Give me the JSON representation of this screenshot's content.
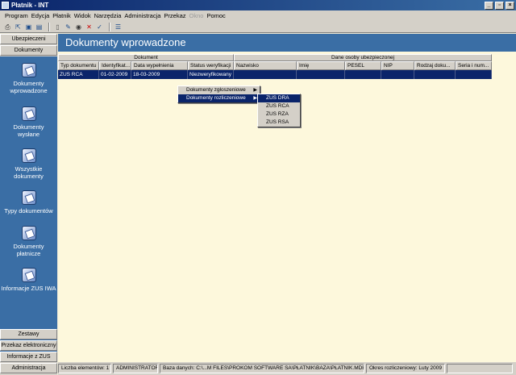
{
  "window": {
    "title": "Płatnik - INT",
    "min": "_",
    "max": "▫",
    "close": "×"
  },
  "menu": [
    "Program",
    "Edycja",
    "Płatnik",
    "Widok",
    "Narzędzia",
    "Administracja",
    "Przekaz",
    "Okno",
    "Pomoc"
  ],
  "menu_disabled_index": 7,
  "sidebar": {
    "top_buttons": [
      "Ubezpieczeni",
      "Dokumenty"
    ],
    "items": [
      {
        "label1": "Dokumenty",
        "label2": "wprowadzone",
        "icon": "doc-in-icon"
      },
      {
        "label1": "Dokumenty",
        "label2": "wysłane",
        "icon": "doc-sent-icon"
      },
      {
        "label1": "Wszystkie",
        "label2": "dokumenty",
        "icon": "all-docs-icon"
      },
      {
        "label1": "Typy dokumentów",
        "label2": "",
        "icon": "doc-types-icon"
      },
      {
        "label1": "Dokumenty",
        "label2": "płatnicze",
        "icon": "payment-docs-icon"
      },
      {
        "label1": "Informacje ZUS IWA",
        "label2": "",
        "icon": "iwa-icon"
      }
    ],
    "bottom_buttons": [
      "Zestawy",
      "Przekaz elektroniczny",
      "Informacje z ZUS",
      "Administracja"
    ]
  },
  "main": {
    "title": "Dokumenty wprowadzone",
    "group_headers": [
      "Dokument",
      "Dane osoby ubezpieczonej"
    ],
    "columns": [
      "Typ dokumentu",
      "Identyfikat...",
      "Data wypełnienia",
      "Status weryfikacji",
      "Nazwisko",
      "Imię",
      "PESEL",
      "NIP",
      "Rodzaj doku...",
      "Seria i num..."
    ],
    "rows": [
      [
        "ZUS RCA",
        "01-02-2009",
        "18-03-2009",
        "Niezweryfikowany",
        "",
        "",
        "",
        "",
        "",
        ""
      ]
    ]
  },
  "context_menu": {
    "items": [
      "Dokumenty zgłoszeniowe",
      "Dokumenty rozliczeniowe"
    ],
    "submenu": [
      "ZUS DRA",
      "ZUS RCA",
      "ZUS RZA",
      "ZUS RSA"
    ]
  },
  "status": {
    "count": "Liczba elementów: 1",
    "user": "ADMINISTRATOR",
    "db": "Baza danych: C:\\...M FILES\\PROKOM SOFTWARE SA\\PŁATNIK\\BAZA\\PŁATNIK.MDB",
    "period": "Okres rozliczeniowy: Luty 2009"
  },
  "colors": {
    "accent": "#3a6ea5",
    "selection": "#0a246a",
    "content_bg": "#fdf8dc"
  }
}
